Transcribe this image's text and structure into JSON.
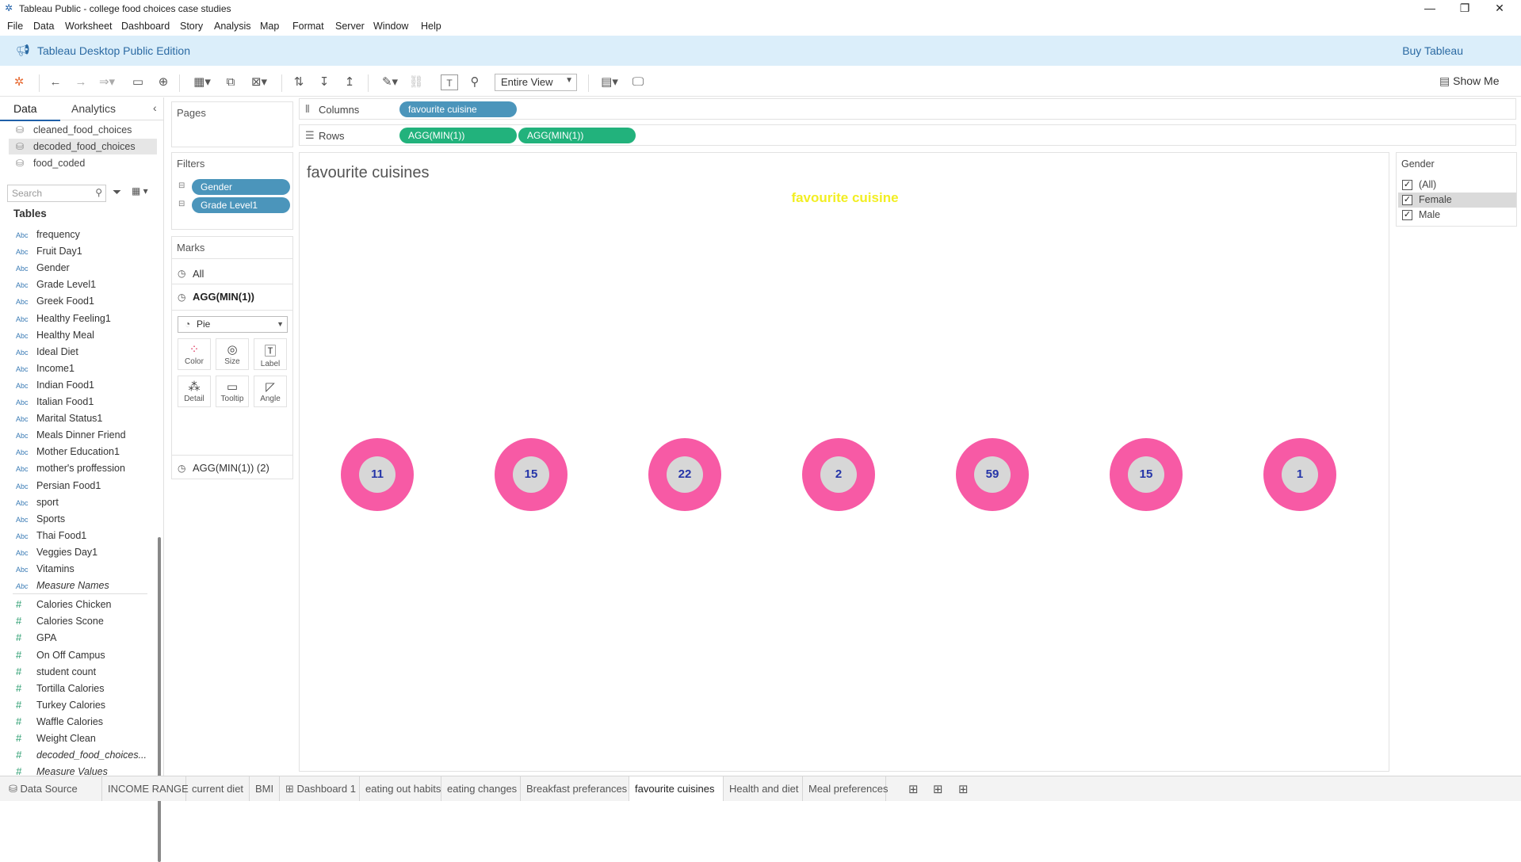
{
  "window": {
    "title": "Tableau Public - college food choices case studies"
  },
  "menu": [
    "File",
    "Data",
    "Worksheet",
    "Dashboard",
    "Story",
    "Analysis",
    "Map",
    "Format",
    "Server",
    "Window",
    "Help"
  ],
  "banner": {
    "edition": "Tableau Desktop Public Edition",
    "buy": "Buy Tableau"
  },
  "toolbar": {
    "fit": "Entire View",
    "show_me": "Show Me"
  },
  "data_pane": {
    "tabs": [
      "Data",
      "Analytics"
    ],
    "sources": [
      "cleaned_food_choices",
      "decoded_food_choices",
      "food_coded"
    ],
    "search_placeholder": "Search",
    "tables_heading": "Tables",
    "dimensions": [
      "frequency",
      "Fruit Day1",
      "Gender",
      "Grade Level1",
      "Greek Food1",
      "Healthy Feeling1",
      "Healthy Meal",
      "Ideal Diet",
      "Income1",
      "Indian Food1",
      "Italian Food1",
      "Marital Status1",
      "Meals Dinner Friend",
      "Mother Education1",
      "mother's proffession",
      "Persian Food1",
      "sport",
      "Sports",
      "Thai Food1",
      "Veggies Day1",
      "Vitamins"
    ],
    "dimension_type": "Abc",
    "measure_names": "Measure Names",
    "measures": [
      "Calories Chicken",
      "Calories Scone",
      "GPA",
      "On Off Campus",
      "student count",
      "Tortilla Calories",
      "Turkey Calories",
      "Waffle Calories",
      "Weight Clean"
    ],
    "extra_measures": [
      "decoded_food_choices...",
      "Measure Values"
    ]
  },
  "pages": {
    "title": "Pages"
  },
  "filters": {
    "title": "Filters",
    "items": [
      "Gender",
      "Grade Level1"
    ]
  },
  "marks": {
    "title": "Marks",
    "all": "All",
    "active": "AGG(MIN(1))",
    "type": "Pie",
    "buttons": [
      "Color",
      "Size",
      "Label",
      "Detail",
      "Tooltip",
      "Angle"
    ],
    "second": "AGG(MIN(1)) (2)"
  },
  "shelves": {
    "columns_label": "Columns",
    "columns": [
      "favourite cuisine"
    ],
    "rows_label": "Rows",
    "rows": [
      "AGG(MIN(1))",
      "AGG(MIN(1))"
    ]
  },
  "view": {
    "sheet_title": "favourite cuisines",
    "column_header": "favourite cuisine",
    "colors": {
      "ring": "#f75aa5",
      "hole": "#d7d7d7",
      "label": "#2535a8",
      "header": "#f2ee22"
    }
  },
  "chart_data": {
    "type": "pie",
    "title": "favourite cuisines",
    "xlabel": "favourite cuisine",
    "values": [
      11,
      15,
      22,
      2,
      59,
      15,
      1
    ]
  },
  "gender_filter": {
    "title": "Gender",
    "options": [
      {
        "label": "(All)",
        "checked": true
      },
      {
        "label": "Female",
        "checked": true
      },
      {
        "label": "Male",
        "checked": true
      }
    ]
  },
  "sheet_tabs": [
    "Data Source",
    "INCOME RANGE",
    "current diet",
    "BMI",
    "Dashboard 1",
    "eating out habits",
    "eating changes",
    "Breakfast preferances",
    "favourite cuisines",
    "Health and diet",
    "Meal preferences"
  ],
  "active_tab": "favourite cuisines"
}
